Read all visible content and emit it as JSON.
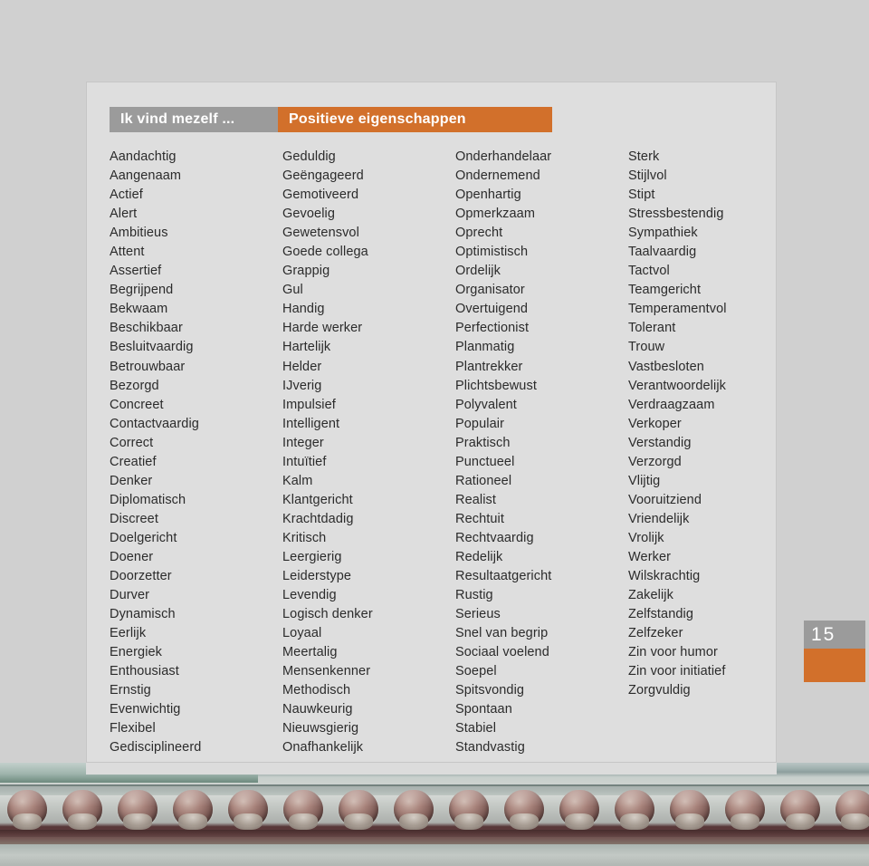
{
  "document": {
    "page_number": "15",
    "colors": {
      "accent_orange": "#d2702b",
      "header_grey": "#9b9b9b",
      "panel_background": "#dedede",
      "page_background": "#d0d0d0",
      "text": "#2b2b2b"
    }
  },
  "header": {
    "left_label": "Ik vind mezelf ...",
    "right_label": "Positieve eigenschappen"
  },
  "columns": [
    {
      "id": "column-1",
      "items": [
        "Aandachtig",
        "Aangenaam",
        "Actief",
        "Alert",
        "Ambitieus",
        "Attent",
        "Assertief",
        "Begrijpend",
        "Bekwaam",
        "Beschikbaar",
        "Besluitvaardig",
        "Betrouwbaar",
        "Bezorgd",
        "Concreet",
        "Contactvaardig",
        "Correct",
        "Creatief",
        "Denker",
        "Diplomatisch",
        "Discreet",
        "Doelgericht",
        "Doener",
        "Doorzetter",
        "Durver",
        "Dynamisch",
        "Eerlijk",
        "Energiek",
        "Enthousiast",
        "Ernstig",
        "Evenwichtig",
        "Flexibel",
        "Gedisciplineerd"
      ]
    },
    {
      "id": "column-2",
      "items": [
        "Geduldig",
        "Geëngageerd",
        "Gemotiveerd",
        "Gevoelig",
        "Gewetensvol",
        "Goede collega",
        "Grappig",
        "Gul",
        "Handig",
        "Harde werker",
        "Hartelijk",
        "Helder",
        "IJverig",
        "Impulsief",
        "Intelligent",
        "Integer",
        "Intuïtief",
        "Kalm",
        "Klantgericht",
        "Krachtdadig",
        "Kritisch",
        "Leergierig",
        "Leiderstype",
        "Levendig",
        "Logisch denker",
        "Loyaal",
        "Meertalig",
        "Mensenkenner",
        "Methodisch",
        "Nauwkeurig",
        "Nieuwsgierig",
        "Onafhankelijk"
      ]
    },
    {
      "id": "column-3",
      "items": [
        "Onderhandelaar",
        "Ondernemend",
        "Openhartig",
        "Opmerkzaam",
        "Oprecht",
        "Optimistisch",
        "Ordelijk",
        "Organisator",
        "Overtuigend",
        "Perfectionist",
        "Planmatig",
        "Plantrekker",
        "Plichtsbewust",
        "Polyvalent",
        "Populair",
        "Praktisch",
        "Punctueel",
        "Rationeel",
        "Realist",
        "Rechtuit",
        "Rechtvaardig",
        "Redelijk",
        "Resultaatgericht",
        "Rustig",
        "Serieus",
        "Snel van begrip",
        "Sociaal voelend",
        "Soepel",
        "Spitsvondig",
        "Spontaan",
        "Stabiel",
        "Standvastig"
      ]
    },
    {
      "id": "column-4",
      "items": [
        "Sterk",
        "Stijlvol",
        "Stipt",
        "Stressbestendig",
        "Sympathiek",
        "Taalvaardig",
        "Tactvol",
        "Teamgericht",
        "Temperamentvol",
        "Tolerant",
        "Trouw",
        "Vastbesloten",
        "Verantwoordelijk",
        "Verdraagzaam",
        "Verkoper",
        "Verstandig",
        "Verzorgd",
        "Vlijtig",
        "Vooruitziend",
        "Vriendelijk",
        "Vrolijk",
        "Werker",
        "Wilskrachtig",
        "Zakelijk",
        "Zelfstandig",
        "Zelfzeker",
        "Zin voor humor",
        "Zin voor initiatief",
        "Zorgvuldig"
      ]
    }
  ],
  "footer_image": {
    "description": "industrial-machine-parts-photo-strip"
  }
}
